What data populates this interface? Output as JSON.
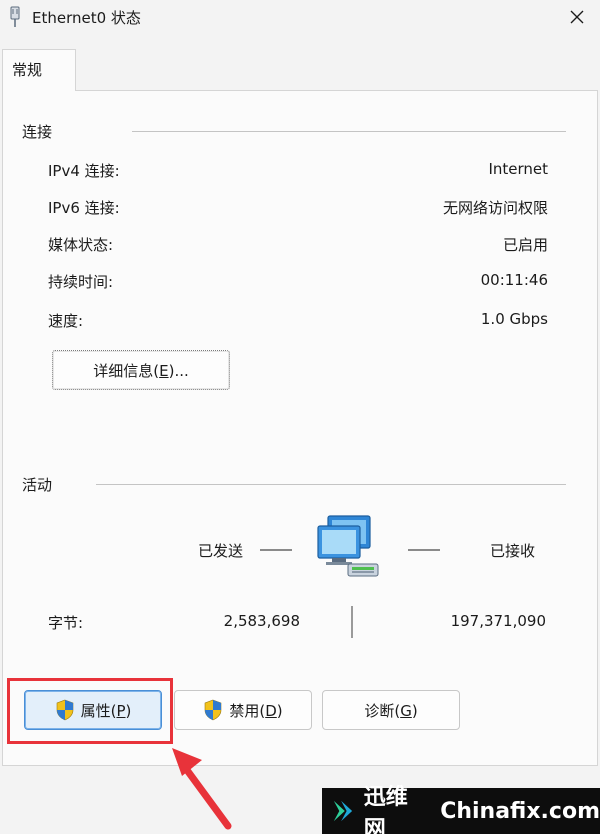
{
  "window": {
    "title": "Ethernet0 状态",
    "icon": "network-adapter-icon"
  },
  "tabs": [
    {
      "label": "常规",
      "active": true
    }
  ],
  "connection": {
    "heading": "连接",
    "rows": [
      {
        "label": "IPv4 连接:",
        "value": "Internet"
      },
      {
        "label": "IPv6 连接:",
        "value": "无网络访问权限"
      },
      {
        "label": "媒体状态:",
        "value": "已启用"
      },
      {
        "label": "持续时间:",
        "value": "00:11:46"
      },
      {
        "label": "速度:",
        "value": "1.0 Gbps"
      }
    ],
    "details_button": {
      "label_prefix": "详细信息(",
      "accel": "E",
      "label_suffix": ")..."
    }
  },
  "activity": {
    "heading": "活动",
    "sent_label": "已发送",
    "received_label": "已接收",
    "bytes_label": "字节:",
    "bytes_sent": "2,583,698",
    "bytes_received": "197,371,090",
    "icon": "network-computers-icon"
  },
  "buttons": {
    "properties": {
      "label_prefix": "属性(",
      "accel": "P",
      "label_suffix": ")"
    },
    "disable": {
      "label_prefix": "禁用(",
      "accel": "D",
      "label_suffix": ")"
    },
    "diagnose": {
      "label_prefix": "诊断(",
      "accel": "G",
      "label_suffix": ")"
    }
  },
  "watermark": {
    "brand_cn": "迅维网",
    "brand_en": "Chinafix.com"
  },
  "colors": {
    "highlight": "#e8333a",
    "primary_button_border": "#4a8fd6",
    "watermark_bg": "#0d0d0d"
  }
}
